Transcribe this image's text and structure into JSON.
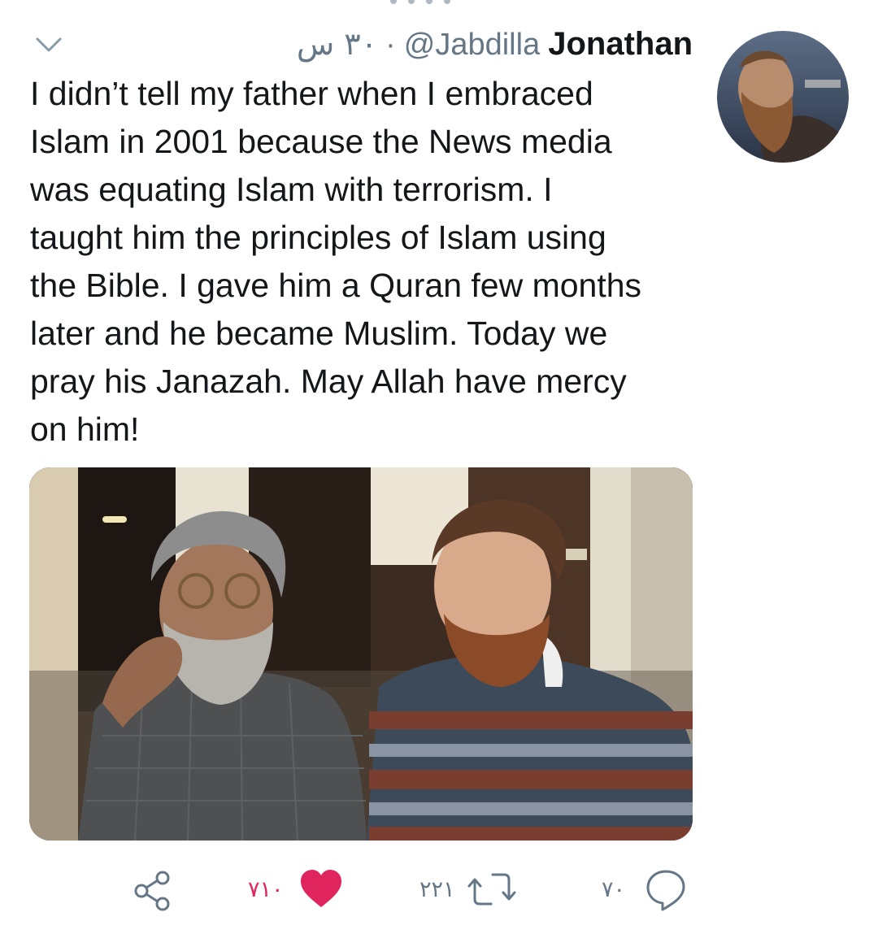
{
  "tweet": {
    "display_name": "Jonathan",
    "handle": "@Jabdilla",
    "separator": "·",
    "time": "۳۰ س",
    "text": "I didn’t tell my father when I embraced Islam in 2001 because the News media was equating Islam with terrorism. I taught him the principles of Islam using the Bible. I gave him a Quran few months later and he became Muslim. Today we pray his Janazah. May Allah have mercy on him!",
    "text_lines": [
      "I didn’t tell my father when I embraced",
      "Islam in 2001 because the News media",
      "was equating Islam with terrorism. I",
      "taught him the principles of Islam using",
      "the Bible. I gave him a Quran few months",
      "later and he became Muslim. Today we",
      "pray his Janazah. May Allah have mercy",
      "on him!"
    ]
  },
  "actions": {
    "reply_count": "۷۰",
    "retweet_count": "۲۲۱",
    "like_count": "۷۱۰",
    "liked": true
  },
  "icons": {
    "caret": "chevron-down-icon",
    "reply": "reply-icon",
    "retweet": "retweet-icon",
    "like": "heart-icon",
    "share": "share-icon"
  },
  "colors": {
    "text": "#14171a",
    "secondary": "#657786",
    "like": "#e0245e"
  }
}
